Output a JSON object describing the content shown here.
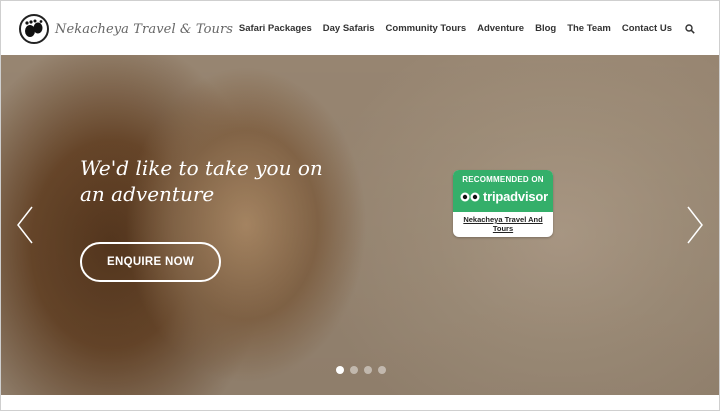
{
  "header": {
    "logo_text": "Nekacheya Travel & Tours",
    "nav": [
      {
        "label": "Safari Packages"
      },
      {
        "label": "Day Safaris"
      },
      {
        "label": "Community Tours"
      },
      {
        "label": "Adventure"
      },
      {
        "label": "Blog"
      },
      {
        "label": "The Team"
      },
      {
        "label": "Contact Us"
      }
    ],
    "search_icon": "search-icon"
  },
  "hero": {
    "headline": "We'd like to take you on an adventure",
    "cta_label": "ENQUIRE NOW",
    "prev_icon": "chevron-left-icon",
    "next_icon": "chevron-right-icon",
    "slides": {
      "count": 4,
      "active": 1
    }
  },
  "tripadvisor": {
    "recommended": "RECOMMENDED ON",
    "brand": "tripadvisor",
    "name": "Nekacheya Travel And Tours",
    "color": "#34af6a"
  }
}
